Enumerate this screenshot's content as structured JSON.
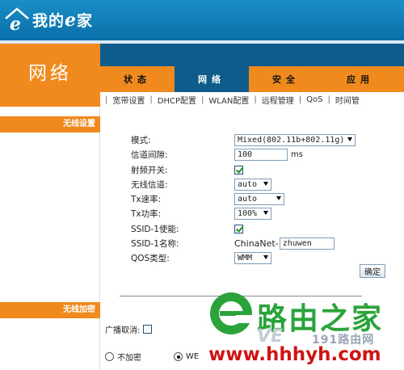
{
  "header": {
    "brand": "我的e家",
    "brand_prefix": "我的",
    "brand_e": "e",
    "brand_suffix": "家",
    "section": "网络"
  },
  "tabs": [
    {
      "label": "状态",
      "active": false
    },
    {
      "label": "网络",
      "active": true
    },
    {
      "label": "安全",
      "active": false
    },
    {
      "label": "应用",
      "active": false
    }
  ],
  "subnav": [
    "宽带设置",
    "DHCP配置",
    "WLAN配置",
    "远程管理",
    "QoS",
    "时间管"
  ],
  "sidebar": {
    "heading1": "无线设置",
    "heading2": "无线加密"
  },
  "form": {
    "mode_label": "模式:",
    "mode_value": "Mixed(802.11b+802.11g)",
    "beacon_label": "信道间隙:",
    "beacon_value": "100",
    "beacon_unit": "ms",
    "rf_label": "射频开关:",
    "rf_checked": true,
    "channel_label": "无线信道:",
    "channel_value": "auto",
    "txrate_label": "Tx速率:",
    "txrate_value": "auto",
    "txpower_label": "Tx功率:",
    "txpower_value": "100%",
    "ssid_enable_label": "SSID-1使能:",
    "ssid_enable_checked": true,
    "ssid_name_label": "SSID-1名称:",
    "ssid_prefix": "ChinaNet-",
    "ssid_value": "zhuwen",
    "qos_label": "QOS类型:",
    "qos_value": "WMM",
    "confirm_label": "确定"
  },
  "encryption": {
    "broadcast_label": "广播取消:",
    "broadcast_checked": false,
    "option_none": "不加密",
    "option_wep": "WE",
    "selected": "WEP"
  },
  "watermark": {
    "brand": "路由之家",
    "sub": "191路由网",
    "faint": "VE",
    "url": "www.hhhyh.com"
  },
  "colors": {
    "header_blue": "#1a8ec6",
    "nav_dark_blue": "#0d5c8c",
    "accent_orange": "#f08a1e",
    "watermark_green": "#2aa33a",
    "watermark_red": "#d01414"
  }
}
